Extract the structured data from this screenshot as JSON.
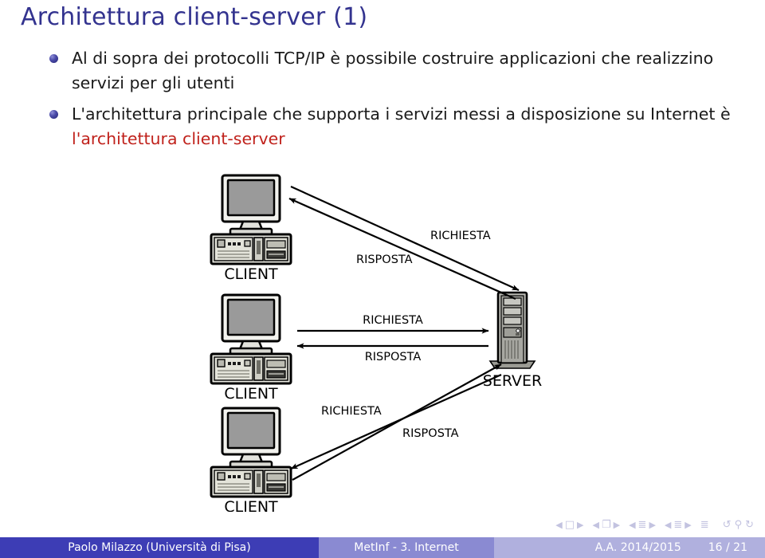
{
  "slide": {
    "title": "Architettura client-server (1)",
    "bullets": [
      {
        "text_plain": "Al di sopra dei protocolli TCP/IP è possibile costruire applicazioni che realizzino servizi per gli utenti",
        "part1": "Al di sopra dei protocolli TCP/IP è possibile costruire applicazioni che realizzino servizi per gli utenti",
        "highlight": ""
      },
      {
        "text_plain": "L'architettura principale che supporta i servizi messi a disposizione su Internet è l'architettura client-server",
        "part1": "L'architettura principale che supporta i servizi messi a disposizione su Internet è ",
        "highlight": "l'architettura client-server"
      }
    ]
  },
  "diagram": {
    "nodes": [
      {
        "id": "client-top",
        "label": "CLIENT",
        "type": "desktop-computer"
      },
      {
        "id": "client-middle",
        "label": "CLIENT",
        "type": "desktop-computer"
      },
      {
        "id": "client-bottom",
        "label": "CLIENT",
        "type": "desktop-computer"
      },
      {
        "id": "server",
        "label": "SERVER",
        "type": "tower-server"
      }
    ],
    "arrow_labels": {
      "request": "RICHIESTA",
      "response": "RISPOSTA"
    },
    "flows": [
      {
        "from": "client-top",
        "to": "server",
        "label": "RICHIESTA"
      },
      {
        "from": "server",
        "to": "client-top",
        "label": "RISPOSTA"
      },
      {
        "from": "client-middle",
        "to": "server",
        "label": "RICHIESTA"
      },
      {
        "from": "server",
        "to": "client-middle",
        "label": "RISPOSTA"
      },
      {
        "from": "client-bottom",
        "to": "server",
        "label": "RICHIESTA"
      },
      {
        "from": "server",
        "to": "client-bottom",
        "label": "RISPOSTA"
      }
    ]
  },
  "navigation": {
    "first_slide": "◀",
    "prev": "◀",
    "next": "▶",
    "last_slide": "▶",
    "slide_glyph": "□",
    "frame_glyph": "❐",
    "subsection_glyph": "≣",
    "section_glyph": "≣",
    "presentation_glyph": "≣",
    "back_glyph": "↺",
    "search_glyph": "⚲",
    "forward_glyph": "↻"
  },
  "footer": {
    "author": "Paolo Milazzo  (Università di Pisa)",
    "section": "MetInf - 3. Internet",
    "academic_year": "A.A. 2014/2015",
    "page": "16 / 21"
  },
  "colors": {
    "title": "#33338f",
    "highlight_red": "#c0221c",
    "footer_primary": "#3d3db5",
    "footer_secondary": "#8a8ad2",
    "footer_tertiary": "#b0b0de",
    "bullet": "#3a3a98"
  }
}
